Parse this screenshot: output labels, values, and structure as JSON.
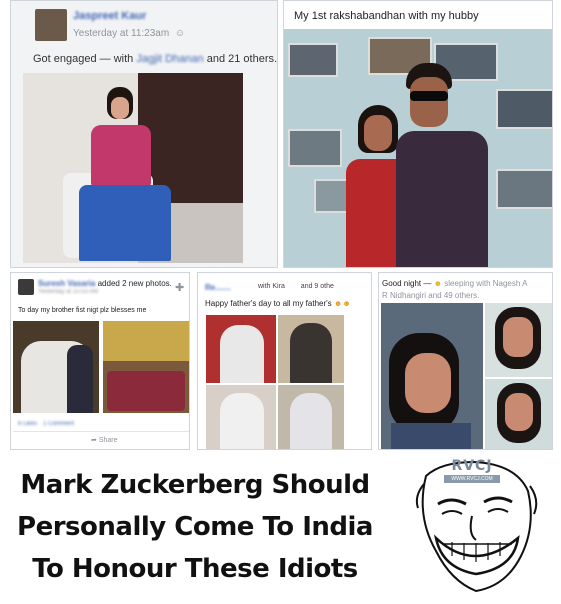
{
  "post1": {
    "author": "Jaspreet Kaur",
    "timestamp": "Yesterday at 11:23am",
    "status_prefix": "Got engaged — with",
    "tagged_name": "Jagjit Dhanan",
    "status_suffix": "and 21 others."
  },
  "post2": {
    "caption": "My 1st rakshabandhan with my hubby"
  },
  "post3": {
    "author": "Suresh Vasaria",
    "action": "added 2 new photos.",
    "timestamp": "Yesterday at 10:53 AM",
    "text": "To day my brother fist nigt plz blesses me",
    "likes": "6 Likes",
    "comments": "1 Comment",
    "share": "Share"
  },
  "post4": {
    "author": "Re.......",
    "with_text": "with Kira",
    "others": "and 9 othe",
    "text": "Happy father's day to all my father's"
  },
  "post5": {
    "prefix": "Good night —",
    "activity": "sleeping with Nagesh A",
    "tag_line": "R Nidhangiri and 49 others."
  },
  "meme": {
    "line1": "Mark Zuckerberg Should",
    "line2": "Personally Come To India",
    "line3": "To Honour These Idiots",
    "logo": "RVCJ",
    "logo_url": "WWW.RVCJ.COM"
  }
}
